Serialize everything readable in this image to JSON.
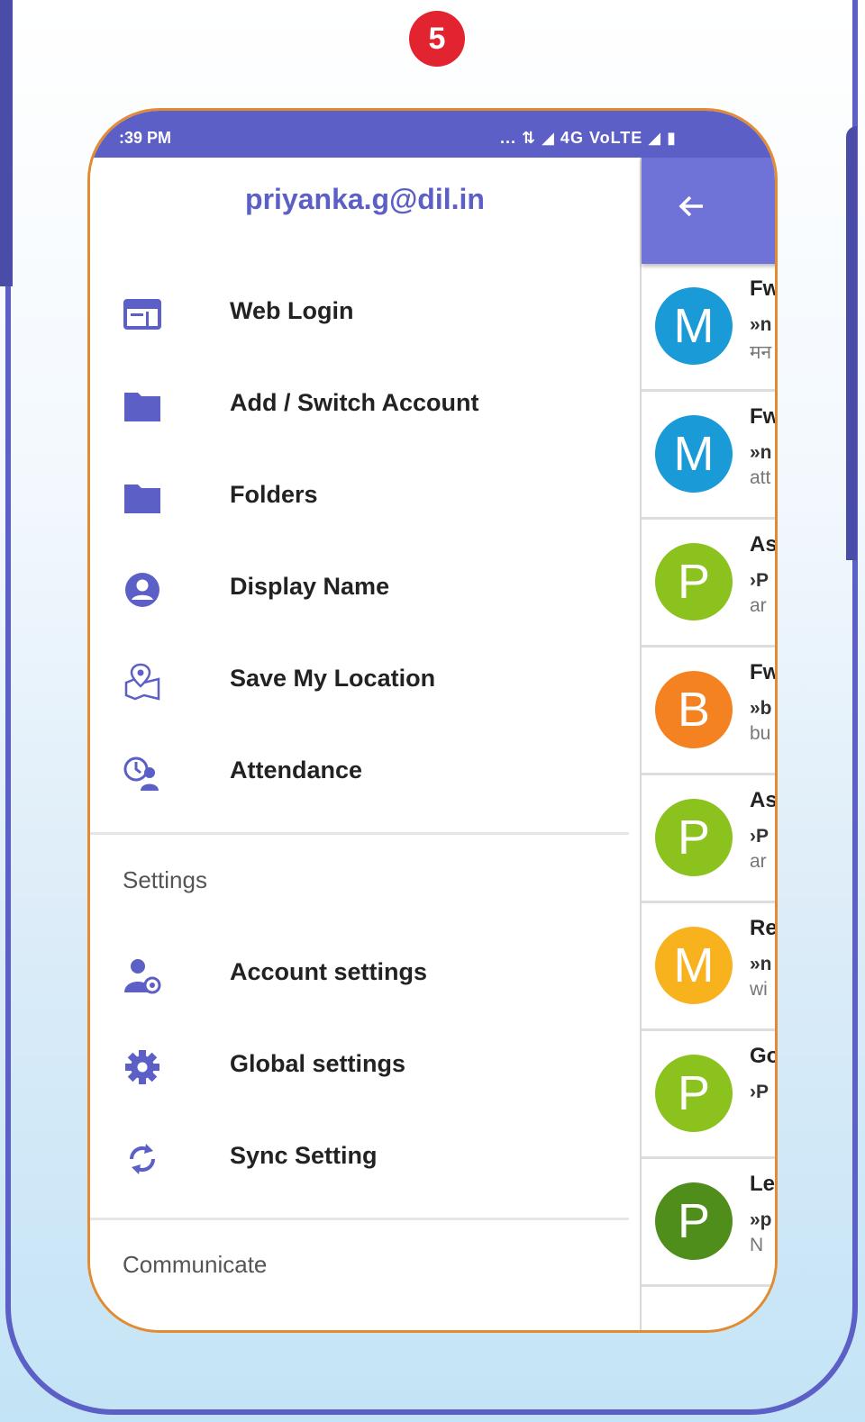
{
  "step_badge": "5",
  "status_bar": {
    "time": ":39 PM",
    "indicators": "... ⇅ ◢ 4G VoLTE ◢ ▮"
  },
  "drawer": {
    "account_email": "priyanka.g@dil.in",
    "menu_items": [
      {
        "label": "Web Login",
        "icon": "web-login-icon"
      },
      {
        "label": "Add / Switch Account",
        "icon": "folder-icon"
      },
      {
        "label": "Folders",
        "icon": "folder-icon"
      },
      {
        "label": "Display Name",
        "icon": "account-circle-icon"
      },
      {
        "label": "Save My Location",
        "icon": "map-pin-icon"
      },
      {
        "label": "Attendance",
        "icon": "attendance-clock-icon"
      }
    ],
    "settings_header": "Settings",
    "settings_items": [
      {
        "label": "Account settings",
        "icon": "user-settings-icon"
      },
      {
        "label": "Global settings",
        "icon": "gear-icon"
      },
      {
        "label": "Sync Setting",
        "icon": "sync-icon"
      }
    ],
    "communicate_header": "Communicate"
  },
  "inbox": {
    "back_icon": "back-arrow-icon",
    "messages": [
      {
        "initial": "M",
        "color": "#1a9ad6",
        "line1": "Fw",
        "line2": "»n",
        "line3": "मन"
      },
      {
        "initial": "M",
        "color": "#1a9ad6",
        "line1": "Fw",
        "line2": "»n",
        "line3": "att"
      },
      {
        "initial": "P",
        "color": "#8cc21e",
        "line1": "As",
        "line2": "›P",
        "line3": "ar"
      },
      {
        "initial": "B",
        "color": "#f58220",
        "line1": "Fw",
        "line2": "»b",
        "line3": "bu"
      },
      {
        "initial": "P",
        "color": "#8cc21e",
        "line1": "As",
        "line2": "›P",
        "line3": "ar"
      },
      {
        "initial": "M",
        "color": "#f8b21e",
        "line1": "Re",
        "line2": "»n",
        "line3": "wi"
      },
      {
        "initial": "P",
        "color": "#8cc21e",
        "line1": "Go",
        "line2": "›P",
        "line3": ""
      },
      {
        "initial": "P",
        "color": "#4f8e1a",
        "line1": "Le",
        "line2": "»p",
        "line3": "N"
      }
    ]
  },
  "colors": {
    "primary": "#5c5fc6",
    "app_bar": "#6f73d8",
    "badge": "#e1242f",
    "phone_border": "#e38b33"
  }
}
